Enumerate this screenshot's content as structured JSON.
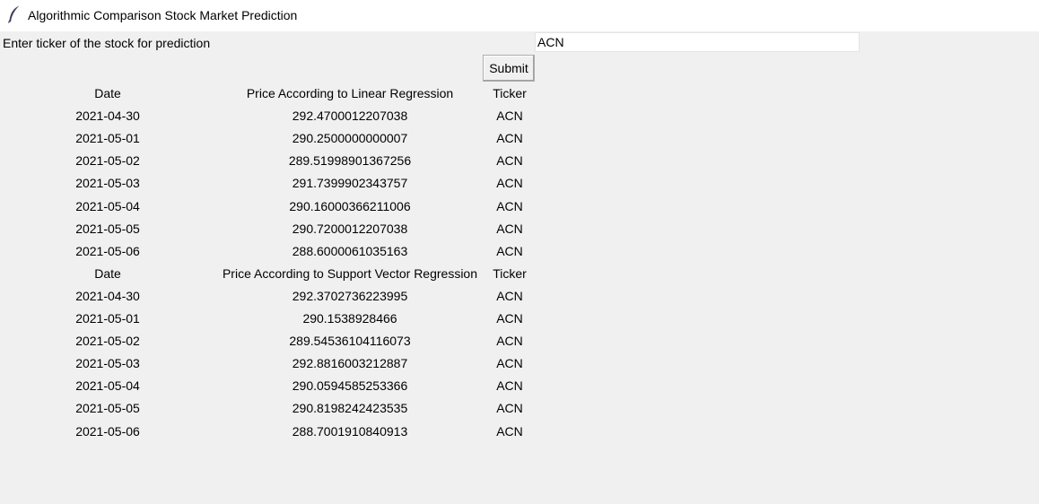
{
  "window": {
    "title": "Algorithmic Comparison Stock Market Prediction",
    "icon": "feather-icon"
  },
  "form": {
    "prompt": "Enter ticker of the stock for prediction",
    "ticker_value": "ACN",
    "submit_label": "Submit"
  },
  "tables": [
    {
      "headers": {
        "date": "Date",
        "price": "Price According to Linear Regression",
        "ticker": "Ticker"
      },
      "rows": [
        {
          "date": "2021-04-30",
          "price": "292.4700012207038",
          "ticker": "ACN"
        },
        {
          "date": "2021-05-01",
          "price": "290.2500000000007",
          "ticker": "ACN"
        },
        {
          "date": "2021-05-02",
          "price": "289.51998901367256",
          "ticker": "ACN"
        },
        {
          "date": "2021-05-03",
          "price": "291.7399902343757",
          "ticker": "ACN"
        },
        {
          "date": "2021-05-04",
          "price": "290.16000366211006",
          "ticker": "ACN"
        },
        {
          "date": "2021-05-05",
          "price": "290.7200012207038",
          "ticker": "ACN"
        },
        {
          "date": "2021-05-06",
          "price": "288.6000061035163",
          "ticker": "ACN"
        }
      ]
    },
    {
      "headers": {
        "date": "Date",
        "price": "Price According to Support Vector Regression",
        "ticker": "Ticker"
      },
      "rows": [
        {
          "date": "2021-04-30",
          "price": "292.3702736223995",
          "ticker": "ACN"
        },
        {
          "date": "2021-05-01",
          "price": "290.1538928466",
          "ticker": "ACN"
        },
        {
          "date": "2021-05-02",
          "price": "289.54536104116073",
          "ticker": "ACN"
        },
        {
          "date": "2021-05-03",
          "price": "292.8816003212887",
          "ticker": "ACN"
        },
        {
          "date": "2021-05-04",
          "price": "290.0594585253366",
          "ticker": "ACN"
        },
        {
          "date": "2021-05-05",
          "price": "290.8198242423535",
          "ticker": "ACN"
        },
        {
          "date": "2021-05-06",
          "price": "288.7001910840913",
          "ticker": "ACN"
        }
      ]
    }
  ]
}
